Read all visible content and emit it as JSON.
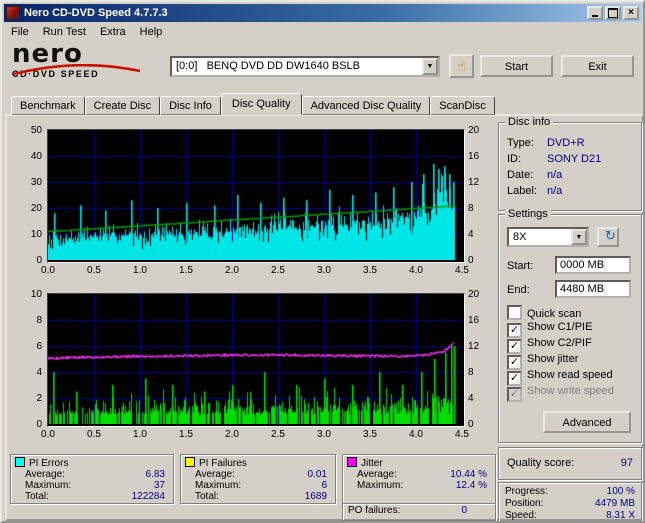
{
  "window": {
    "title": "Nero CD-DVD Speed 4.7.7.3"
  },
  "menu": {
    "items": [
      "File",
      "Run Test",
      "Extra",
      "Help"
    ]
  },
  "toolbar": {
    "logo_text": "nero",
    "logo_subtitle": "CD·DVD SPEED",
    "drive": "[0:0]   BENQ DVD DD DW1640 BSLB",
    "start_label": "Start",
    "exit_label": "Exit"
  },
  "tabs": {
    "items": [
      "Benchmark",
      "Create Disc",
      "Disc Info",
      "Disc Quality",
      "Advanced Disc Quality",
      "ScanDisc"
    ],
    "active": "Disc Quality"
  },
  "disc_info": {
    "title": "Disc info",
    "rows": [
      {
        "label": "Type:",
        "value": "DVD+R"
      },
      {
        "label": "ID:",
        "value": "SONY D21"
      },
      {
        "label": "Date:",
        "value": "n/a"
      },
      {
        "label": "Label:",
        "value": "n/a"
      }
    ]
  },
  "settings": {
    "title": "Settings",
    "speed_value": "8X",
    "start_label": "Start:",
    "start_value": "0000 MB",
    "end_label": "End:",
    "end_value": "4480 MB",
    "checkboxes": [
      {
        "label": "Quick scan",
        "checked": false,
        "disabled": false
      },
      {
        "label": "Show C1/PIE",
        "checked": true,
        "disabled": false
      },
      {
        "label": "Show C2/PIF",
        "checked": true,
        "disabled": false
      },
      {
        "label": "Show jitter",
        "checked": true,
        "disabled": false
      },
      {
        "label": "Show read speed",
        "checked": true,
        "disabled": false
      },
      {
        "label": "Show write speed",
        "checked": true,
        "disabled": true
      }
    ],
    "advanced_label": "Advanced"
  },
  "quality": {
    "label": "Quality score:",
    "value": "97"
  },
  "progress": {
    "rows": [
      {
        "label": "Progress:",
        "value": "100 %"
      },
      {
        "label": "Position:",
        "value": "4479 MB"
      },
      {
        "label": "Speed:",
        "value": "8.31 X"
      }
    ]
  },
  "stats": {
    "panels": [
      {
        "title": "PI Errors",
        "swatch": "#00ffff",
        "rows": [
          {
            "label": "Average:",
            "value": "6.83"
          },
          {
            "label": "Maximum:",
            "value": "37"
          },
          {
            "label": "Total:",
            "value": "122284"
          }
        ]
      },
      {
        "title": "PI Failures",
        "swatch": "#ffff00",
        "rows": [
          {
            "label": "Average:",
            "value": "0.01"
          },
          {
            "label": "Maximum:",
            "value": "6"
          },
          {
            "label": "Total:",
            "value": "1689"
          }
        ]
      },
      {
        "title": "Jitter",
        "swatch": "#ff00ff",
        "rows": [
          {
            "label": "Average:",
            "value": "10.44 %"
          },
          {
            "label": "Maximum:",
            "value": "12.4 %"
          }
        ]
      }
    ],
    "po_failures": {
      "label": "PO failures:",
      "value": "0"
    }
  },
  "chart_data": [
    {
      "id": "chart-pi-errors",
      "type": "area",
      "title": "PI Errors (cyan, left axis 0-50) and read speed (green line, right axis 0-20 X) vs disc position (GB)",
      "x_max": 4.5,
      "x_data_end": 4.42,
      "x_tick_labels": [
        "0.0",
        "0.5",
        "1.0",
        "1.5",
        "2.0",
        "2.5",
        "3.0",
        "3.5",
        "4.0",
        "4.5"
      ],
      "left_axis": {
        "max": 50,
        "ticks": [
          50,
          40,
          30,
          20,
          10,
          0
        ]
      },
      "right_axis": {
        "max": 20,
        "ticks": [
          20,
          16,
          12,
          8,
          4,
          0
        ]
      },
      "bg": "#000000",
      "grid_color": "#000090",
      "series": [
        {
          "name": "PI Errors",
          "style": "noise-bars",
          "axis": "left",
          "color": "#00e5e5",
          "seed": 7,
          "min_draw": 0.5,
          "mean": [
            [
              0,
              8
            ],
            [
              0.5,
              9
            ],
            [
              1,
              9.5
            ],
            [
              1.5,
              10
            ],
            [
              2,
              11
            ],
            [
              2.5,
              12
            ],
            [
              3,
              13
            ],
            [
              3.5,
              14.5
            ],
            [
              3.8,
              16
            ],
            [
              4,
              17
            ],
            [
              4.2,
              19
            ],
            [
              4.35,
              21
            ],
            [
              4.42,
              17
            ]
          ],
          "amp": [
            [
              0,
              5
            ],
            [
              1,
              6
            ],
            [
              2,
              7
            ],
            [
              3,
              8
            ],
            [
              3.8,
              9
            ],
            [
              4.1,
              14
            ],
            [
              4.3,
              16
            ],
            [
              4.42,
              12
            ]
          ],
          "spikes": [
            [
              0.07,
              18
            ],
            [
              0.35,
              21
            ],
            [
              0.62,
              19
            ],
            [
              0.9,
              23
            ],
            [
              1.18,
              20
            ],
            [
              1.5,
              22
            ],
            [
              1.8,
              21
            ],
            [
              2.05,
              25
            ],
            [
              2.3,
              22
            ],
            [
              2.55,
              24
            ],
            [
              2.8,
              23
            ],
            [
              3.05,
              27
            ],
            [
              3.3,
              25
            ],
            [
              3.55,
              26
            ],
            [
              3.75,
              28
            ],
            [
              3.95,
              30
            ],
            [
              4.08,
              33
            ],
            [
              4.18,
              37
            ],
            [
              4.24,
              35
            ],
            [
              4.3,
              36
            ],
            [
              4.36,
              33
            ],
            [
              4.4,
              30
            ]
          ]
        },
        {
          "name": "Read speed",
          "style": "line",
          "axis": "right",
          "color": "#00a000",
          "seed": 3,
          "noise": 0.06,
          "width": 1.4,
          "points": [
            [
              0,
              4.35
            ],
            [
              4.42,
              8.31
            ]
          ]
        }
      ]
    },
    {
      "id": "chart-pi-failures",
      "type": "area",
      "title": "PI Failures (green bars, left axis 0-10) and jitter % (magenta line, right axis 0-20) vs disc position (GB)",
      "x_max": 4.5,
      "x_data_end": 4.42,
      "x_tick_labels": [
        "0.0",
        "0.5",
        "1.0",
        "1.5",
        "2.0",
        "2.5",
        "3.0",
        "3.5",
        "4.0",
        "4.5"
      ],
      "left_axis": {
        "max": 10,
        "ticks": [
          10,
          8,
          6,
          4,
          2,
          0
        ]
      },
      "right_axis": {
        "max": 20,
        "ticks": [
          20,
          16,
          12,
          8,
          4,
          0
        ]
      },
      "bg": "#000000",
      "grid_color": "#000090",
      "series": [
        {
          "name": "PI Failures",
          "style": "noise-bars",
          "axis": "left",
          "color": "#00dc00",
          "seed": 11,
          "min_draw": 0.7,
          "mean": [
            [
              0,
              0.8
            ],
            [
              4,
              1.0
            ],
            [
              4.42,
              1.8
            ]
          ],
          "amp": [
            [
              0,
              1.6
            ],
            [
              2,
              1.8
            ],
            [
              4,
              1.9
            ],
            [
              4.3,
              2.6
            ],
            [
              4.42,
              3.0
            ]
          ],
          "spikes": [
            [
              0.05,
              4
            ],
            [
              0.3,
              2.5
            ],
            [
              0.7,
              3
            ],
            [
              1.05,
              3.5
            ],
            [
              1.35,
              3
            ],
            [
              1.7,
              2.5
            ],
            [
              2.0,
              3
            ],
            [
              2.35,
              4
            ],
            [
              2.7,
              3
            ],
            [
              3.0,
              3.5
            ],
            [
              3.3,
              3
            ],
            [
              3.6,
              4
            ],
            [
              3.85,
              3
            ],
            [
              4.05,
              4
            ],
            [
              4.2,
              5
            ],
            [
              4.32,
              5.5
            ],
            [
              4.38,
              6
            ],
            [
              4.41,
              6
            ]
          ]
        },
        {
          "name": "Jitter",
          "style": "line",
          "axis": "right",
          "color": "#ff30ff",
          "seed": 5,
          "noise": 0.18,
          "width": 1.4,
          "points": [
            [
              0,
              10.1
            ],
            [
              0.5,
              10.3
            ],
            [
              1,
              10.4
            ],
            [
              1.5,
              10.5
            ],
            [
              2,
              10.6
            ],
            [
              2.6,
              10.6
            ],
            [
              3.2,
              10.5
            ],
            [
              3.8,
              10.4
            ],
            [
              4.1,
              10.6
            ],
            [
              4.3,
              11.2
            ],
            [
              4.38,
              12.0
            ],
            [
              4.42,
              12.4
            ]
          ]
        }
      ]
    }
  ]
}
